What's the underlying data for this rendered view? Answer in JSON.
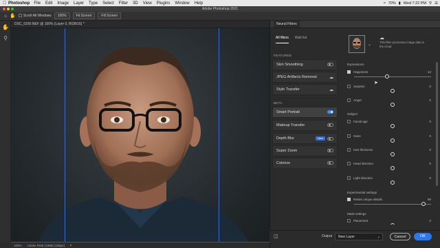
{
  "menubar": {
    "app_name": "Photoshop",
    "items": [
      "File",
      "Edit",
      "Image",
      "Layer",
      "Type",
      "Select",
      "Filter",
      "3D",
      "View",
      "Plugins",
      "Window",
      "Help"
    ],
    "battery": "70%",
    "clock": "Wed 7:22 PM"
  },
  "window": {
    "title": "Adobe Photoshop 2021"
  },
  "options_bar": {
    "scroll_all": "Scroll All Windows",
    "zoom": "100%",
    "fit": "Fit Screen",
    "fill": "Fill Screen"
  },
  "document": {
    "tab": "DSC_0160.NEF @ 100% (Layer 0, RGB/16) *",
    "zoom": "100%",
    "profile": "Adobe RGB (1998) (16bpc)"
  },
  "neural": {
    "panel_title": "Neural Filters",
    "tabs": [
      "All filters",
      "Wait list"
    ],
    "featured_label": "FEATURED",
    "beta_label": "BETA",
    "featured": [
      {
        "name": "Skin Smoothing",
        "state": "toggle-off"
      },
      {
        "name": "JPEG Artifacts Removal",
        "state": "cloud"
      },
      {
        "name": "Style Transfer",
        "state": "cloud"
      }
    ],
    "beta": [
      {
        "name": "Smart Portrait",
        "state": "toggle-on"
      },
      {
        "name": "Makeup Transfer",
        "state": "toggle-off"
      },
      {
        "name": "Depth Blur",
        "state": "new-toggle",
        "badge": "New"
      },
      {
        "name": "Super Zoom",
        "state": "toggle-off"
      },
      {
        "name": "Colorize",
        "state": "toggle-off"
      }
    ]
  },
  "settings": {
    "cloud_note": "This filter processes image data in the cloud",
    "expressions_label": "Expressions",
    "happiness": {
      "label": "Happiness",
      "value": "-13",
      "checked": true,
      "level": 0.43
    },
    "surprise": {
      "label": "Surprise",
      "value": "0",
      "checked": false,
      "level": 0.5
    },
    "anger": {
      "label": "Anger",
      "value": "0",
      "checked": false,
      "level": 0.5
    },
    "subject_label": "Subject",
    "facial_age": {
      "label": "Facial age",
      "value": "0",
      "level": 0.5
    },
    "gaze": {
      "label": "Gaze",
      "value": "0",
      "level": 0.5
    },
    "hair_thickness": {
      "label": "Hair thickness",
      "value": "0",
      "level": 0.5
    },
    "head_direction": {
      "label": "Head direction",
      "value": "0",
      "level": 0.5
    },
    "light_direction": {
      "label": "Light direction",
      "value": "0",
      "level": 0.5
    },
    "experimental_label": "Experimental settings",
    "retain": {
      "label": "Retain unique details",
      "value": "90",
      "checked": true,
      "level": 0.9
    },
    "mask_label": "Mask settings",
    "placement": {
      "label": "Placement",
      "value": "0",
      "level": 0.5
    }
  },
  "footer": {
    "output_label": "Output",
    "output_value": "New Layer",
    "cancel": "Cancel",
    "ok": "OK"
  },
  "colors": {
    "accent": "#2d78e6",
    "guide": "#3a6ad8"
  }
}
